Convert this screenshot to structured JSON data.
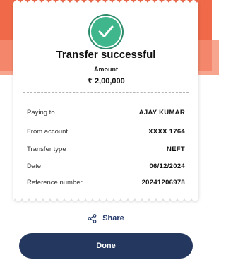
{
  "receipt": {
    "title": "Transfer successful",
    "amount_label": "Amount",
    "amount_value": "₹  2,00,000",
    "status_icon": "check-icon",
    "details": [
      {
        "label": "Paying to",
        "value": "AJAY KUMAR"
      },
      {
        "label": "From account",
        "value": "XXXX 1764"
      },
      {
        "label": "Transfer type",
        "value": "NEFT"
      },
      {
        "label": "Date",
        "value": "06/12/2024"
      },
      {
        "label": "Reference number",
        "value": "20241206978"
      }
    ]
  },
  "actions": {
    "share_label": "Share",
    "share_icon": "share-icon",
    "done_label": "Done"
  },
  "colors": {
    "header_bg": "#f06a4a",
    "success_green": "#3fb68b",
    "primary_navy": "#23375f",
    "share_text": "#253a6b"
  }
}
